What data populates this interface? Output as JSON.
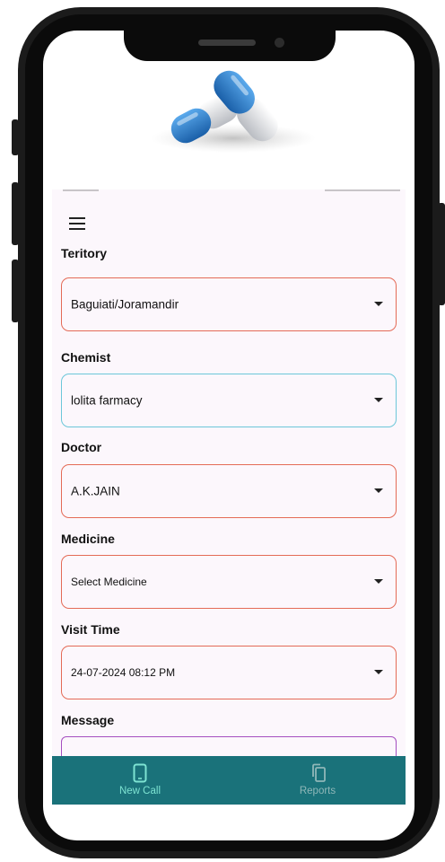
{
  "form": {
    "territory": {
      "label": "Teritory",
      "value": "Baguiati/Joramandir"
    },
    "chemist": {
      "label": "Chemist",
      "value": "lolita farmacy"
    },
    "doctor": {
      "label": "Doctor",
      "value": "A.K.JAIN"
    },
    "medicine": {
      "label": "Medicine",
      "value": "Select Medicine"
    },
    "visit_time": {
      "label": "Visit Time",
      "value": "24-07-2024 08:12 PM"
    },
    "message": {
      "label": "Message",
      "value": ""
    }
  },
  "bottom_nav": {
    "items": [
      {
        "label": "New Call",
        "icon": "phone-icon",
        "active": true
      },
      {
        "label": "Reports",
        "icon": "copy-icon",
        "active": false
      }
    ]
  },
  "colors": {
    "nav_bg": "#1a727a",
    "nav_active": "#7de3d2",
    "nav_inactive": "#8fb7b8",
    "field_border": "#e46b57",
    "focused_border": "#6cc7d9",
    "message_border": "#a54fc0",
    "app_bg": "#fcf7fc"
  }
}
